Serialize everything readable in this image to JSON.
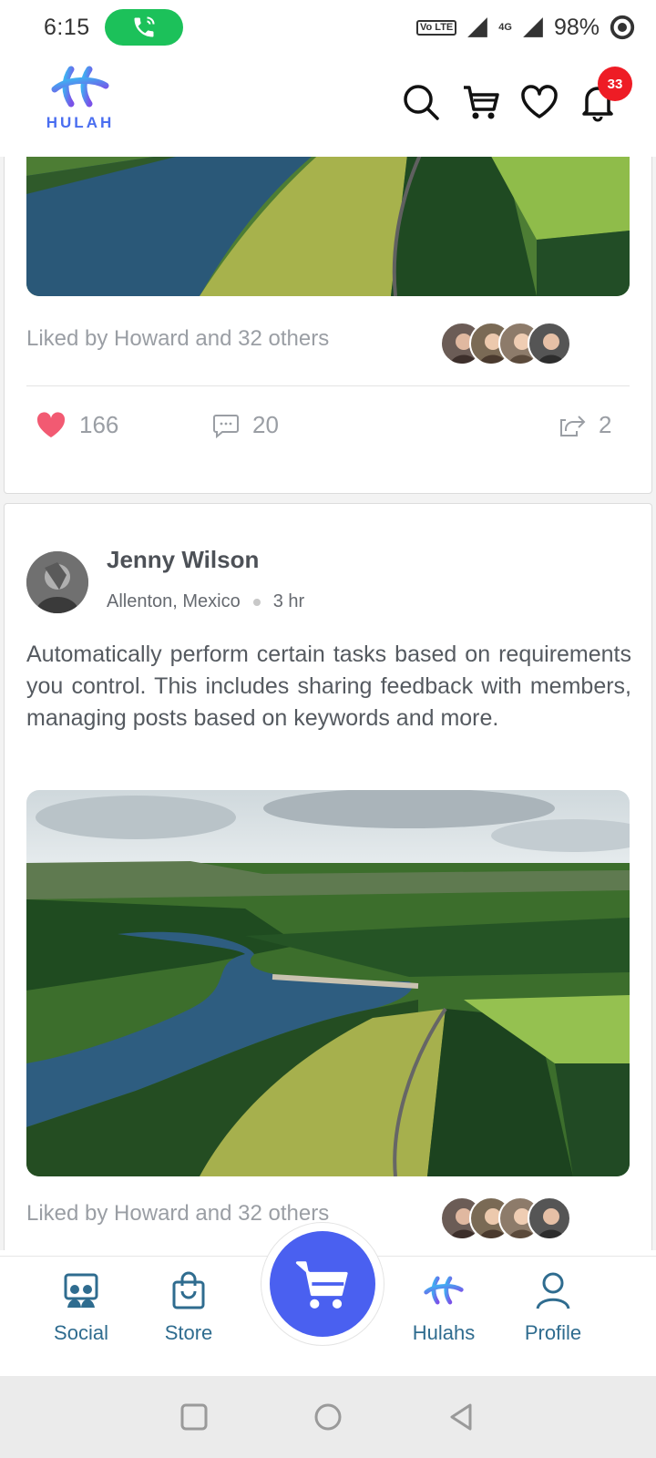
{
  "status_bar": {
    "time": "6:15",
    "network_volte": "Vo LTE",
    "network_type": "4G",
    "battery": "98%",
    "call_color": "#1cc15a"
  },
  "header": {
    "logo_text": "HULAH",
    "notification_count": "33",
    "icons": [
      "search-icon",
      "cart-icon",
      "heart-icon",
      "bell-icon"
    ],
    "accent": "#4a6ef0"
  },
  "post_top": {
    "liked_by": "Liked by Howard and 32 others",
    "likes": "166",
    "comments": "20",
    "shares": "2"
  },
  "post_main": {
    "author": "Jenny Wilson",
    "location": "Allenton, Mexico",
    "time_ago": "3 hr",
    "text": "Automatically perform certain tasks based on requirements you control. This includes sharing feedback with members, managing posts based on keywords and more.",
    "liked_by": "Liked by Howard and 32 others"
  },
  "bottom_nav": {
    "social": "Social",
    "store": "Store",
    "hulahs": "Hulahs",
    "profile": "Profile",
    "center_color": "#4a60f0"
  }
}
